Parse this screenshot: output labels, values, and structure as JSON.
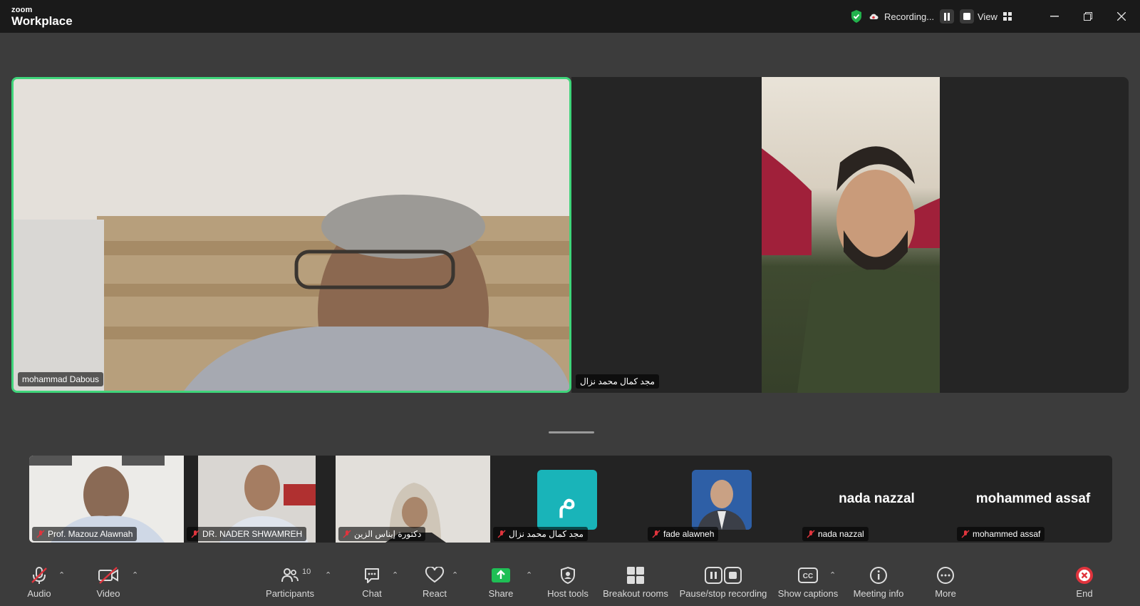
{
  "app": {
    "brand_small": "zoom",
    "brand_large": "Workplace"
  },
  "titlebar": {
    "recording_label": "Recording...",
    "view_label": "View",
    "window_controls": [
      "minimize",
      "restore",
      "close"
    ]
  },
  "main_tiles": [
    {
      "name": "mohammad Dabous",
      "active_speaker": true
    },
    {
      "name": "مجد كمال محمد نزال",
      "active_speaker": false
    }
  ],
  "gallery": [
    {
      "name": "Prof. Mazouz Alawnah",
      "muted": true
    },
    {
      "name": "DR. NADER SHWAMREH",
      "muted": true
    },
    {
      "name": "دكتورة إيناس الزين",
      "muted": true
    },
    {
      "name": "مجد كمال محمد نزال",
      "muted": true,
      "avatar_letter": "م",
      "avatar_color": "#19b4b9"
    },
    {
      "name": "fade alawneh",
      "muted": true
    },
    {
      "name": "nada nazzal",
      "muted": true,
      "display_text": "nada nazzal"
    },
    {
      "name": "mohammed assaf",
      "muted": true,
      "display_text": "mohammed assaf"
    }
  ],
  "toolbar": {
    "audio": "Audio",
    "video": "Video",
    "participants": "Participants",
    "participants_count": "10",
    "chat": "Chat",
    "react": "React",
    "share": "Share",
    "host_tools": "Host tools",
    "breakout": "Breakout rooms",
    "pause_recording": "Pause/stop recording",
    "captions": "Show captions",
    "meeting_info": "Meeting info",
    "more": "More",
    "end": "End"
  },
  "colors": {
    "active_border": "#3fd47a",
    "share_green": "#1fbf55",
    "end_red": "#e0343d",
    "mute_red": "#e0343d"
  }
}
